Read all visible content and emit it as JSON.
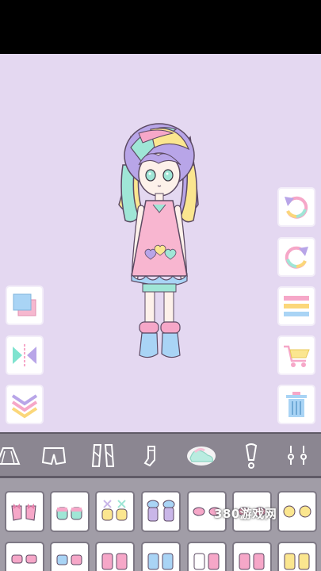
{
  "watermark": "380游戏网",
  "colors": {
    "background": "#e4d8f1",
    "category_bar": "#8b8691",
    "items_panel": "#a19da7",
    "pink": "#f6a7c8",
    "mint": "#9fe6d6",
    "yellow": "#fbe68f",
    "lavender": "#b8a5e8",
    "blue": "#a9d4f5"
  },
  "left_tools": [
    {
      "name": "layer-order-button",
      "icon": "layers-icon"
    },
    {
      "name": "flip-button",
      "icon": "mirror-flip-icon"
    },
    {
      "name": "collapse-button",
      "icon": "double-chevron-down-icon"
    }
  ],
  "right_tools": [
    {
      "name": "undo-button",
      "icon": "undo-icon"
    },
    {
      "name": "redo-button",
      "icon": "redo-icon"
    },
    {
      "name": "menu-button",
      "icon": "stripes-menu-icon"
    },
    {
      "name": "shop-button",
      "icon": "cart-icon"
    },
    {
      "name": "delete-button",
      "icon": "trash-icon"
    }
  ],
  "categories": [
    {
      "name": "skirt",
      "icon": "skirt-icon"
    },
    {
      "name": "pants",
      "icon": "shorts-icon"
    },
    {
      "name": "tights",
      "icon": "tights-icon"
    },
    {
      "name": "socks",
      "icon": "socks-icon"
    },
    {
      "name": "shoes",
      "icon": "shoes-icon",
      "selected": true
    },
    {
      "name": "accessory",
      "icon": "exclamation-icon"
    },
    {
      "name": "earrings",
      "icon": "earrings-icon"
    }
  ],
  "items": [
    {
      "icon": "pink-bow-shoes-icon"
    },
    {
      "icon": "mint-shoes-icon"
    },
    {
      "icon": "yellow-lace-shoes-icon"
    },
    {
      "icon": "lavender-fluffy-boots-icon"
    },
    {
      "icon": "pink-flats-icon"
    },
    {
      "icon": "rose-flats-icon"
    },
    {
      "icon": "yellow-flats-icon"
    },
    {
      "icon": "pink-sandals-icon"
    },
    {
      "icon": "blue-sandals-icon"
    },
    {
      "icon": "pink-heart-boots-icon"
    },
    {
      "icon": "blue-boots-icon"
    },
    {
      "icon": "white-boots-icon"
    },
    {
      "icon": "yellow-boots-icon"
    }
  ]
}
